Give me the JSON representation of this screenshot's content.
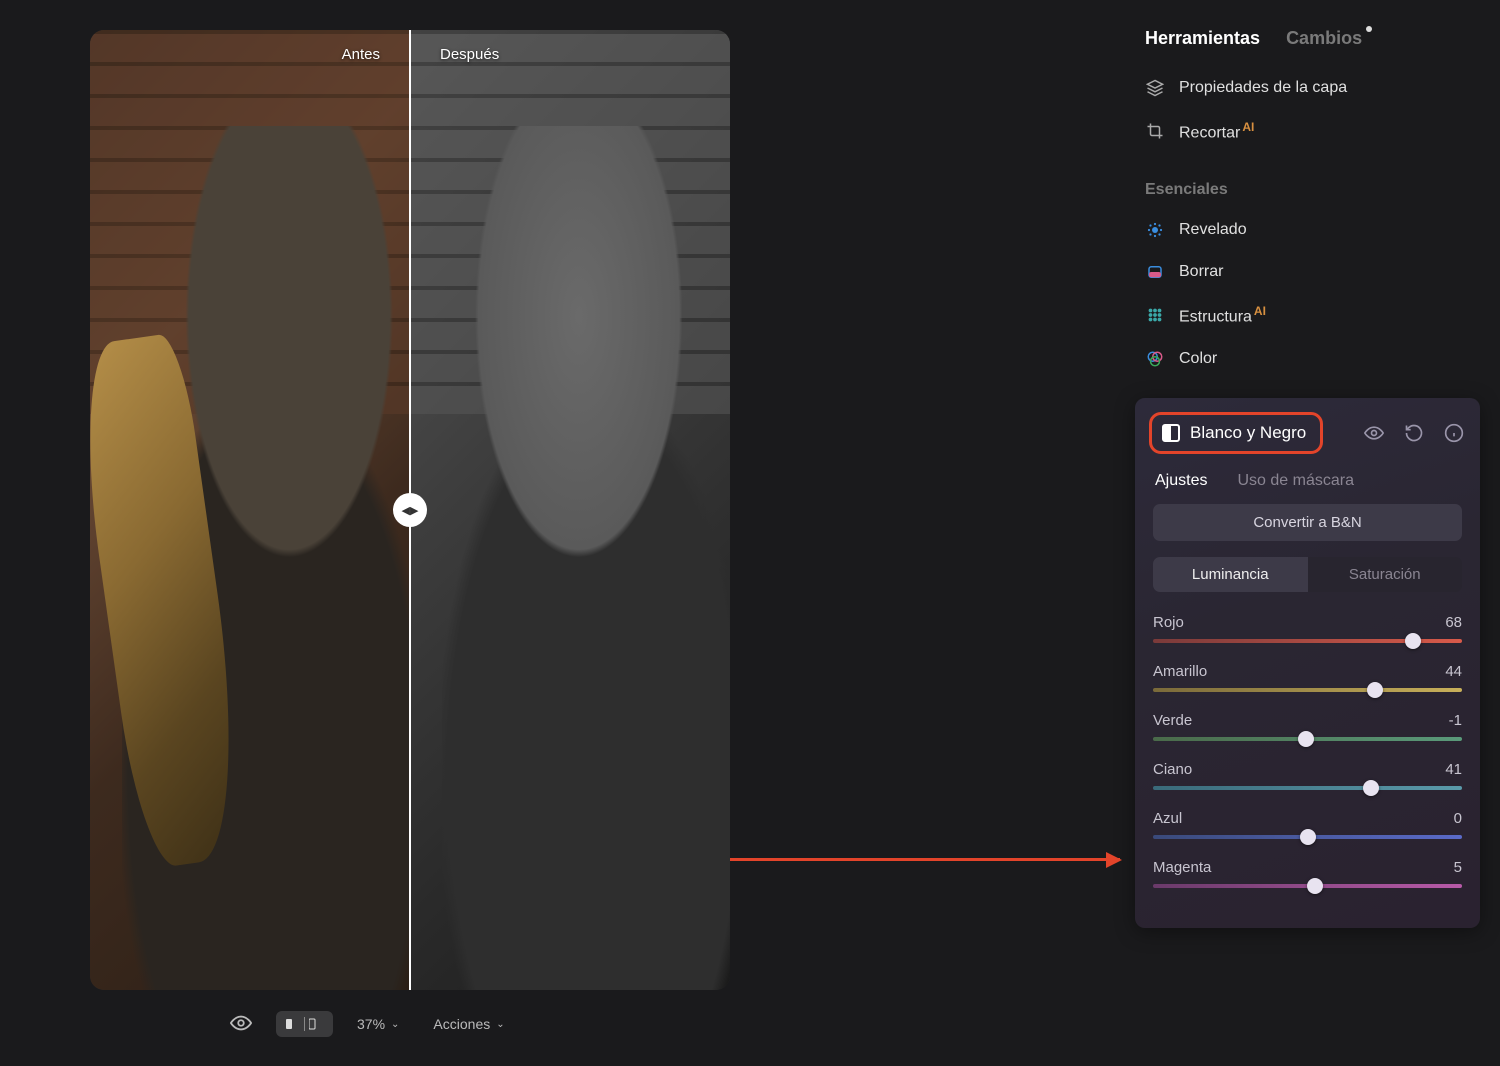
{
  "compare": {
    "before": "Antes",
    "after": "Después"
  },
  "bottom": {
    "zoom": "37%",
    "actions": "Acciones"
  },
  "panel": {
    "tabs": {
      "tools": "Herramientas",
      "changes": "Cambios"
    },
    "layer_props": "Propiedades de la capa",
    "crop": "Recortar",
    "section": "Esenciales",
    "items": {
      "develop": "Revelado",
      "erase": "Borrar",
      "structure": "Estructura",
      "color": "Color"
    }
  },
  "bn": {
    "title": "Blanco y Negro",
    "tabs": {
      "adjust": "Ajustes",
      "mask": "Uso de máscara"
    },
    "convert": "Convertir a B&N",
    "seg": {
      "lum": "Luminancia",
      "sat": "Saturación"
    },
    "sliders": [
      {
        "label": "Rojo",
        "value": 68,
        "color1": "#7a3a3a",
        "color2": "#d85a4a"
      },
      {
        "label": "Amarillo",
        "value": 44,
        "color1": "#7a6a3a",
        "color2": "#c8b05a"
      },
      {
        "label": "Verde",
        "value": -1,
        "color1": "#4a6a4a",
        "color2": "#5a9a7a"
      },
      {
        "label": "Ciano",
        "value": 41,
        "color1": "#3a6a7a",
        "color2": "#5a9aaa"
      },
      {
        "label": "Azul",
        "value": 0,
        "color1": "#3a4a7a",
        "color2": "#5a6ac8"
      },
      {
        "label": "Magenta",
        "value": 5,
        "color1": "#6a3a6a",
        "color2": "#b85aa8"
      }
    ]
  }
}
